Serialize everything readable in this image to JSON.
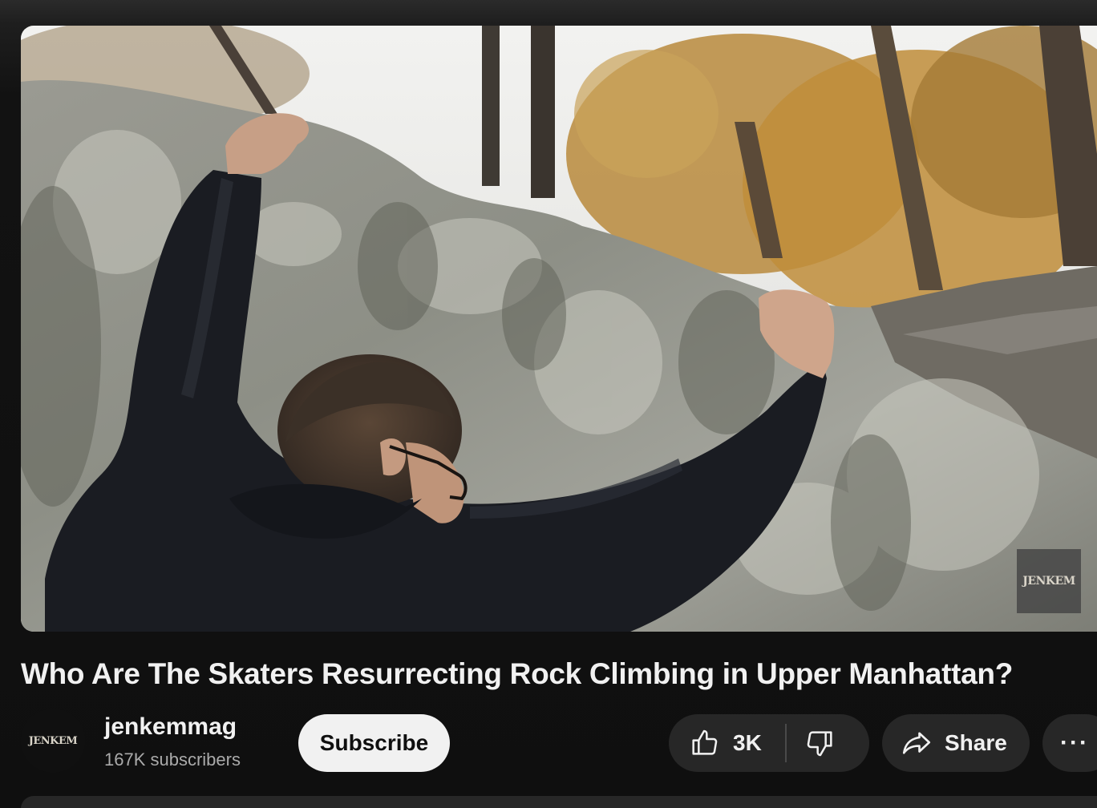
{
  "video": {
    "watermark": "JENKEM",
    "title": "Who Are The Skaters Resurrecting Rock Climbing in Upper Manhattan?"
  },
  "channel": {
    "avatar_text": "JENKEM",
    "name": "jenkemmag",
    "subscribers": "167K subscribers"
  },
  "actions": {
    "subscribe_label": "Subscribe",
    "like_count": "3K",
    "share_label": "Share",
    "more_label": "···"
  },
  "icons": {
    "like": "thumbs-up-icon",
    "dislike": "thumbs-down-icon",
    "share": "share-arrow-icon",
    "more": "more-horizontal-icon"
  },
  "colors": {
    "background": "#0f0f0f",
    "button_bg": "#272727",
    "subscribe_bg": "#f1f1f1",
    "text_primary": "#f1f1f1",
    "text_secondary": "#aaaaaa"
  }
}
